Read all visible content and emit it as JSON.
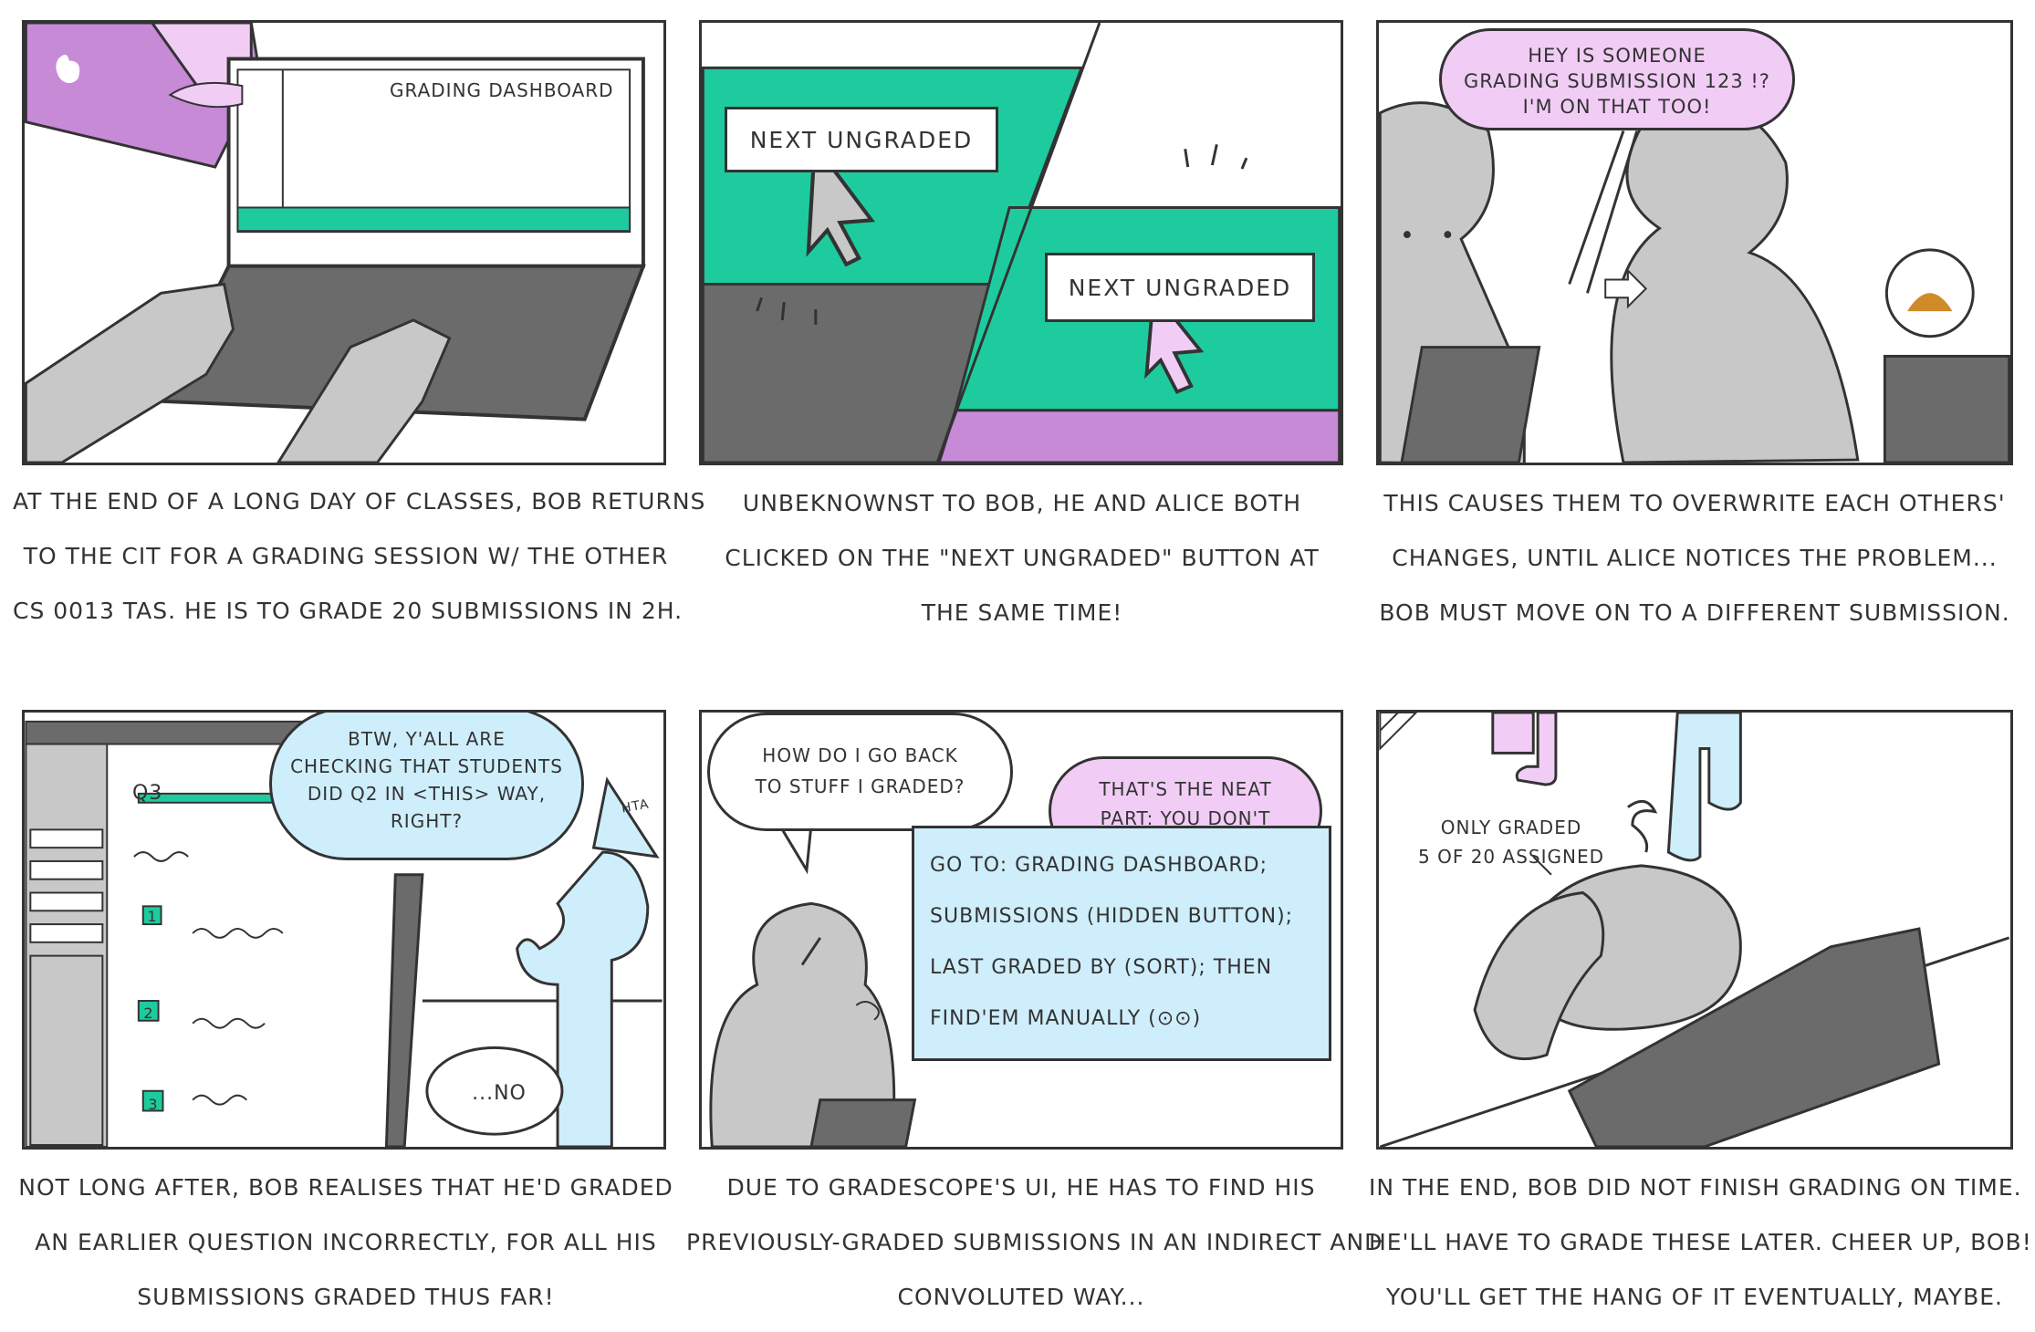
{
  "panels": [
    {
      "caption": [
        "AT THE END OF A LONG DAY OF CLASSES, BOB RETURNS",
        "TO THE CIT FOR A GRADING SESSION W/ THE OTHER",
        "CS 0013 TAS. HE IS TO GRADE 20 SUBMISSIONS IN 2H."
      ],
      "screen_title": "GRADING DASHBOARD"
    },
    {
      "caption": [
        "UNBEKNOWNST TO BOB, HE AND ALICE BOTH",
        "CLICKED ON THE \"NEXT UNGRADED\" BUTTON AT",
        "THE SAME TIME!"
      ],
      "button_label_1": "NEXT UNGRADED",
      "button_label_2": "NEXT UNGRADED"
    },
    {
      "caption": [
        "THIS CAUSES THEM TO OVERWRITE EACH OTHERS'",
        "CHANGES, UNTIL ALICE NOTICES THE PROBLEM...",
        "BOB MUST MOVE ON TO A DIFFERENT SUBMISSION."
      ],
      "speech": [
        "HEY IS SOMEONE",
        "GRADING SUBMISSION 123 !?",
        "I'M ON THAT TOO!"
      ]
    },
    {
      "caption": [
        "NOT LONG AFTER, BOB REALISES THAT HE'D GRADED",
        "AN EARLIER QUESTION INCORRECTLY, FOR ALL HIS",
        "SUBMISSIONS GRADED THUS FAR!"
      ],
      "speech": [
        "BTW, Y'ALL ARE",
        "CHECKING THAT STUDENTS",
        "DID Q2 IN <THIS> WAY,",
        "RIGHT?"
      ],
      "hat_label": "HTA",
      "question_label": "Q3",
      "item_numbers": [
        "1",
        "2",
        "3"
      ],
      "reply": "...NO"
    },
    {
      "caption": [
        "DUE TO GRADESCOPE'S UI, HE HAS TO FIND HIS",
        "PREVIOUSLY-GRADED SUBMISSIONS IN AN INDIRECT AND",
        "CONVOLUTED WAY..."
      ],
      "speech_left": [
        "HOW DO I GO BACK",
        "TO STUFF I GRADED?"
      ],
      "speech_right": [
        "THAT'S THE NEAT",
        "PART: YOU DON'T"
      ],
      "instructions": [
        "GO TO: GRADING DASHBOARD;",
        "SUBMISSIONS (HIDDEN BUTTON);",
        "LAST GRADED BY (SORT); THEN",
        "FIND'EM MANUALLY (⊙⊙)"
      ]
    },
    {
      "caption": [
        "IN THE END, BOB DID NOT FINISH GRADING ON TIME.",
        "HE'LL HAVE TO GRADE THESE LATER. CHEER UP, BOB!",
        "YOU'LL GET THE HANG OF IT EVENTUALLY, MAYBE."
      ],
      "note": [
        "ONLY GRADED",
        "5 OF 20 ASSIGNED"
      ]
    }
  ],
  "colors": {
    "teal": "#1ecb9e",
    "purple": "#c68ad6",
    "light_purple": "#f1cdf6",
    "light_blue": "#cfeefc",
    "gray": "#c8c8c8",
    "dark_gray": "#6b6b6b",
    "outline": "#333333"
  }
}
